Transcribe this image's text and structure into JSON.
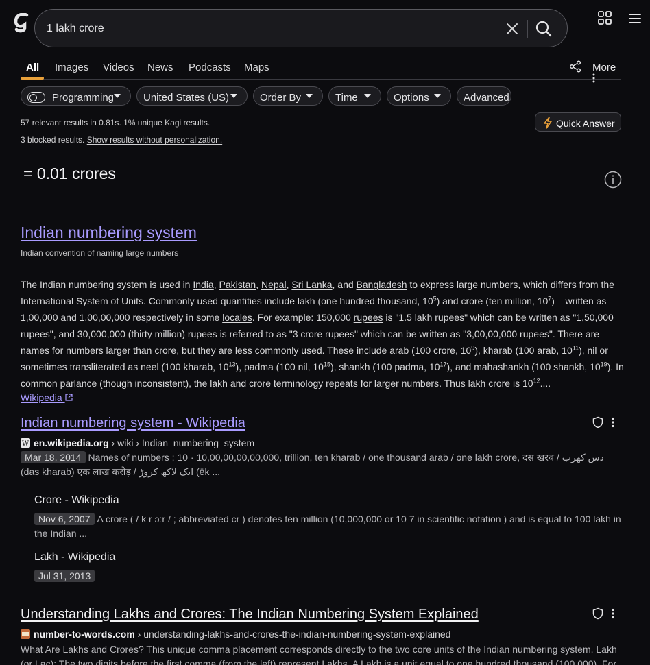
{
  "search": {
    "query": "1 lakh crore"
  },
  "tabs": [
    "All",
    "Images",
    "Videos",
    "News",
    "Podcasts",
    "Maps"
  ],
  "more_label": "More",
  "filters": {
    "programming": "Programming",
    "region": "United States (US)",
    "order": "Order By",
    "time": "Time",
    "options": "Options",
    "advanced": "Advanced"
  },
  "stats": {
    "count": "57",
    "count_text": " relevant results in ",
    "time": "0.81s",
    "unique": ". 1% unique Kagi results.",
    "blocked": "3 blocked results. ",
    "personalization": "Show results without personalization."
  },
  "quick_answer": "Quick Answer",
  "calculator": {
    "result": "= 0.01 crores"
  },
  "wiki": {
    "title": "Indian numbering system",
    "subtitle": "Indian convention of naming large numbers",
    "source": "Wikipedia"
  },
  "results": [
    {
      "title": "Indian numbering system - Wikipedia",
      "domain": "en.wikipedia.org",
      "path": "› wiki › Indian_numbering_system",
      "date": "Mar 18, 2014",
      "snippet": "Names of numbers ; 10 · 10,00,00,00,00,000, trillion, ten kharab / one thousand arab / one lakh crore, दस खरब / دس کھرب (das kharab) एक लाख करोड़ / ایک لاکھ کروڑ (ēk ...",
      "sublinks": [
        {
          "title": "Crore - Wikipedia",
          "date": "Nov 6, 2007",
          "snippet": "A crore ( / k r ɔːr / ; abbreviated cr ) denotes ten million (10,000,000 or 10 7 in scientific notation ) and is equal to 100 lakh in the Indian ..."
        },
        {
          "title": "Lakh - Wikipedia",
          "date": "Jul 31, 2013"
        }
      ]
    },
    {
      "title": "Understanding Lakhs and Crores: The Indian Numbering System Explained",
      "domain": "number-to-words.com",
      "path": "› understanding-lakhs-and-crores-the-indian-numbering-system-explained",
      "snippet": "What Are Lakhs and Crores? This unique comma placement corresponds directly to the two core units of the Indian numbering system. Lakh (or Lac): The two digits before the first comma (from the left) represent Lakhs. A Lakh is a unit equal to one hundred thousand (100,000). For"
    }
  ],
  "colors": {
    "accent": "#a99bff",
    "tab_active": "#e8a03a",
    "background": "#0c0c0f"
  }
}
